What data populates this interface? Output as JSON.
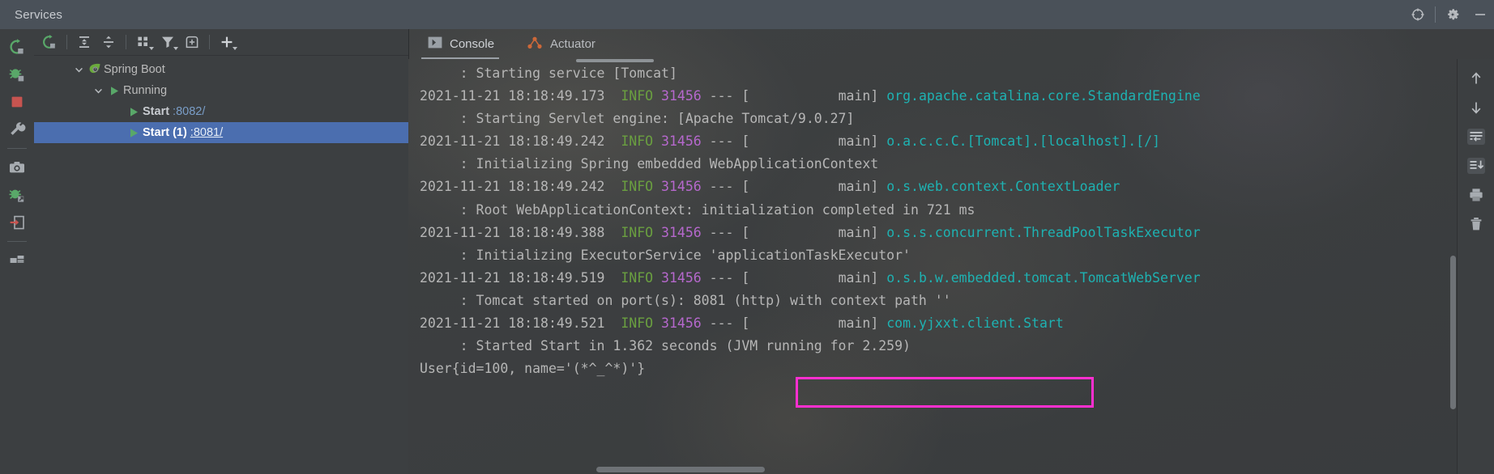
{
  "window": {
    "title": "Services",
    "icons": {
      "target": "target-icon",
      "settings": "gear-icon",
      "minimize": "minimize-icon"
    }
  },
  "colors": {
    "titlebar_bg": "#4a5159",
    "panel_bg": "#3c3f41",
    "selection_blue": "#4b6eaf",
    "accent_green": "#6a9f40",
    "accent_magenta": "#b668cd",
    "accent_cyan": "#1eb2b2",
    "highlight_box": "#ff2fd0",
    "link_blue": "#7a9ec8",
    "actuator_orange": "#cd6839"
  },
  "left_strip": {
    "buttons": [
      {
        "name": "rerun-icon",
        "tooltip": "Rerun"
      },
      {
        "name": "debug-icon",
        "tooltip": "Debug"
      },
      {
        "name": "stop-icon",
        "tooltip": "Stop"
      },
      {
        "name": "wrench-icon",
        "tooltip": "Edit Configuration"
      },
      {
        "name": "camera-icon",
        "tooltip": "Snapshot"
      },
      {
        "name": "bug-export-icon",
        "tooltip": "Attach Debugger"
      },
      {
        "name": "thread-dump-icon",
        "tooltip": "Thread Dump"
      },
      {
        "name": "layout-icon",
        "tooltip": "Layout"
      }
    ]
  },
  "tree_toolbar": {
    "buttons": [
      {
        "name": "rerun-service-icon",
        "tooltip": "Rerun"
      },
      {
        "name": "expand-all-icon",
        "tooltip": "Expand All"
      },
      {
        "name": "collapse-all-icon",
        "tooltip": "Collapse All"
      },
      {
        "name": "group-by-icon",
        "tooltip": "Group By",
        "has_caret": true
      },
      {
        "name": "filter-icon",
        "tooltip": "Filter",
        "has_caret": true
      },
      {
        "name": "add-tab-icon",
        "tooltip": "Add Tab"
      },
      {
        "name": "add-service-icon",
        "tooltip": "Add Service",
        "has_caret": true
      }
    ]
  },
  "tree": {
    "nodes": [
      {
        "label": "Spring Boot",
        "icon": "spring-boot-leaf-icon",
        "expanded": true,
        "indent": 0,
        "selected": false,
        "port": "",
        "bold": false
      },
      {
        "label": "Running",
        "icon": "run-play-icon",
        "expanded": true,
        "indent": 1,
        "selected": false,
        "port": "",
        "bold": false
      },
      {
        "label": "Start",
        "icon": "run-play-icon",
        "expanded": null,
        "indent": 2,
        "selected": false,
        "port": ":8082/",
        "bold": true
      },
      {
        "label": "Start (1)",
        "icon": "run-play-icon",
        "expanded": null,
        "indent": 2,
        "selected": true,
        "port": ":8081/",
        "bold": true
      }
    ]
  },
  "tabs": [
    {
      "label": "Console",
      "icon": "console-icon",
      "active": true
    },
    {
      "label": "Actuator",
      "icon": "actuator-graph-icon",
      "active": false
    }
  ],
  "console_right_toolbar": {
    "buttons": [
      {
        "name": "scroll-up-icon",
        "tooltip": "Up"
      },
      {
        "name": "scroll-down-icon",
        "tooltip": "Down"
      },
      {
        "name": "soft-wrap-icon",
        "tooltip": "Soft-Wrap"
      },
      {
        "name": "scroll-to-end-icon",
        "tooltip": "Scroll to End"
      },
      {
        "name": "print-icon",
        "tooltip": "Print"
      },
      {
        "name": "trash-icon",
        "tooltip": "Clear All"
      }
    ]
  },
  "console": {
    "highlighted_text": "User{id=100, name='(*^_^*)'}",
    "lines": [
      {
        "type": "cont",
        "message": "     : Starting service [Tomcat]"
      },
      {
        "type": "log",
        "timestamp": "2021-11-21 18:18:49.173",
        "level": "INFO",
        "pid": "31456",
        "dashes": "---",
        "thread": "[           main]",
        "logger": "org.apache.catalina.core.StandardEngine"
      },
      {
        "type": "cont",
        "message": "     : Starting Servlet engine: [Apache Tomcat/9.0.27]"
      },
      {
        "type": "log",
        "timestamp": "2021-11-21 18:18:49.242",
        "level": "INFO",
        "pid": "31456",
        "dashes": "---",
        "thread": "[           main]",
        "logger": "o.a.c.c.C.[Tomcat].[localhost].[/]"
      },
      {
        "type": "cont",
        "message": "     : Initializing Spring embedded WebApplicationContext"
      },
      {
        "type": "log",
        "timestamp": "2021-11-21 18:18:49.242",
        "level": "INFO",
        "pid": "31456",
        "dashes": "---",
        "thread": "[           main]",
        "logger": "o.s.web.context.ContextLoader"
      },
      {
        "type": "cont",
        "message": "     : Root WebApplicationContext: initialization completed in 721 ms"
      },
      {
        "type": "log",
        "timestamp": "2021-11-21 18:18:49.388",
        "level": "INFO",
        "pid": "31456",
        "dashes": "---",
        "thread": "[           main]",
        "logger": "o.s.s.concurrent.ThreadPoolTaskExecutor"
      },
      {
        "type": "cont",
        "message": "     : Initializing ExecutorService 'applicationTaskExecutor'"
      },
      {
        "type": "log",
        "timestamp": "2021-11-21 18:18:49.519",
        "level": "INFO",
        "pid": "31456",
        "dashes": "---",
        "thread": "[           main]",
        "logger": "o.s.b.w.embedded.tomcat.TomcatWebServer"
      },
      {
        "type": "cont",
        "message": "     : Tomcat started on port(s): 8081 (http) with context path ''"
      },
      {
        "type": "log",
        "timestamp": "2021-11-21 18:18:49.521",
        "level": "INFO",
        "pid": "31456",
        "dashes": "---",
        "thread": "[           main]",
        "logger": "com.yjxxt.client.Start"
      },
      {
        "type": "cont",
        "message": "     : Started Start in 1.362 seconds (JVM running for 2.259)"
      },
      {
        "type": "plain",
        "message": "User{id=100, name='(*^_^*)'}"
      }
    ]
  }
}
